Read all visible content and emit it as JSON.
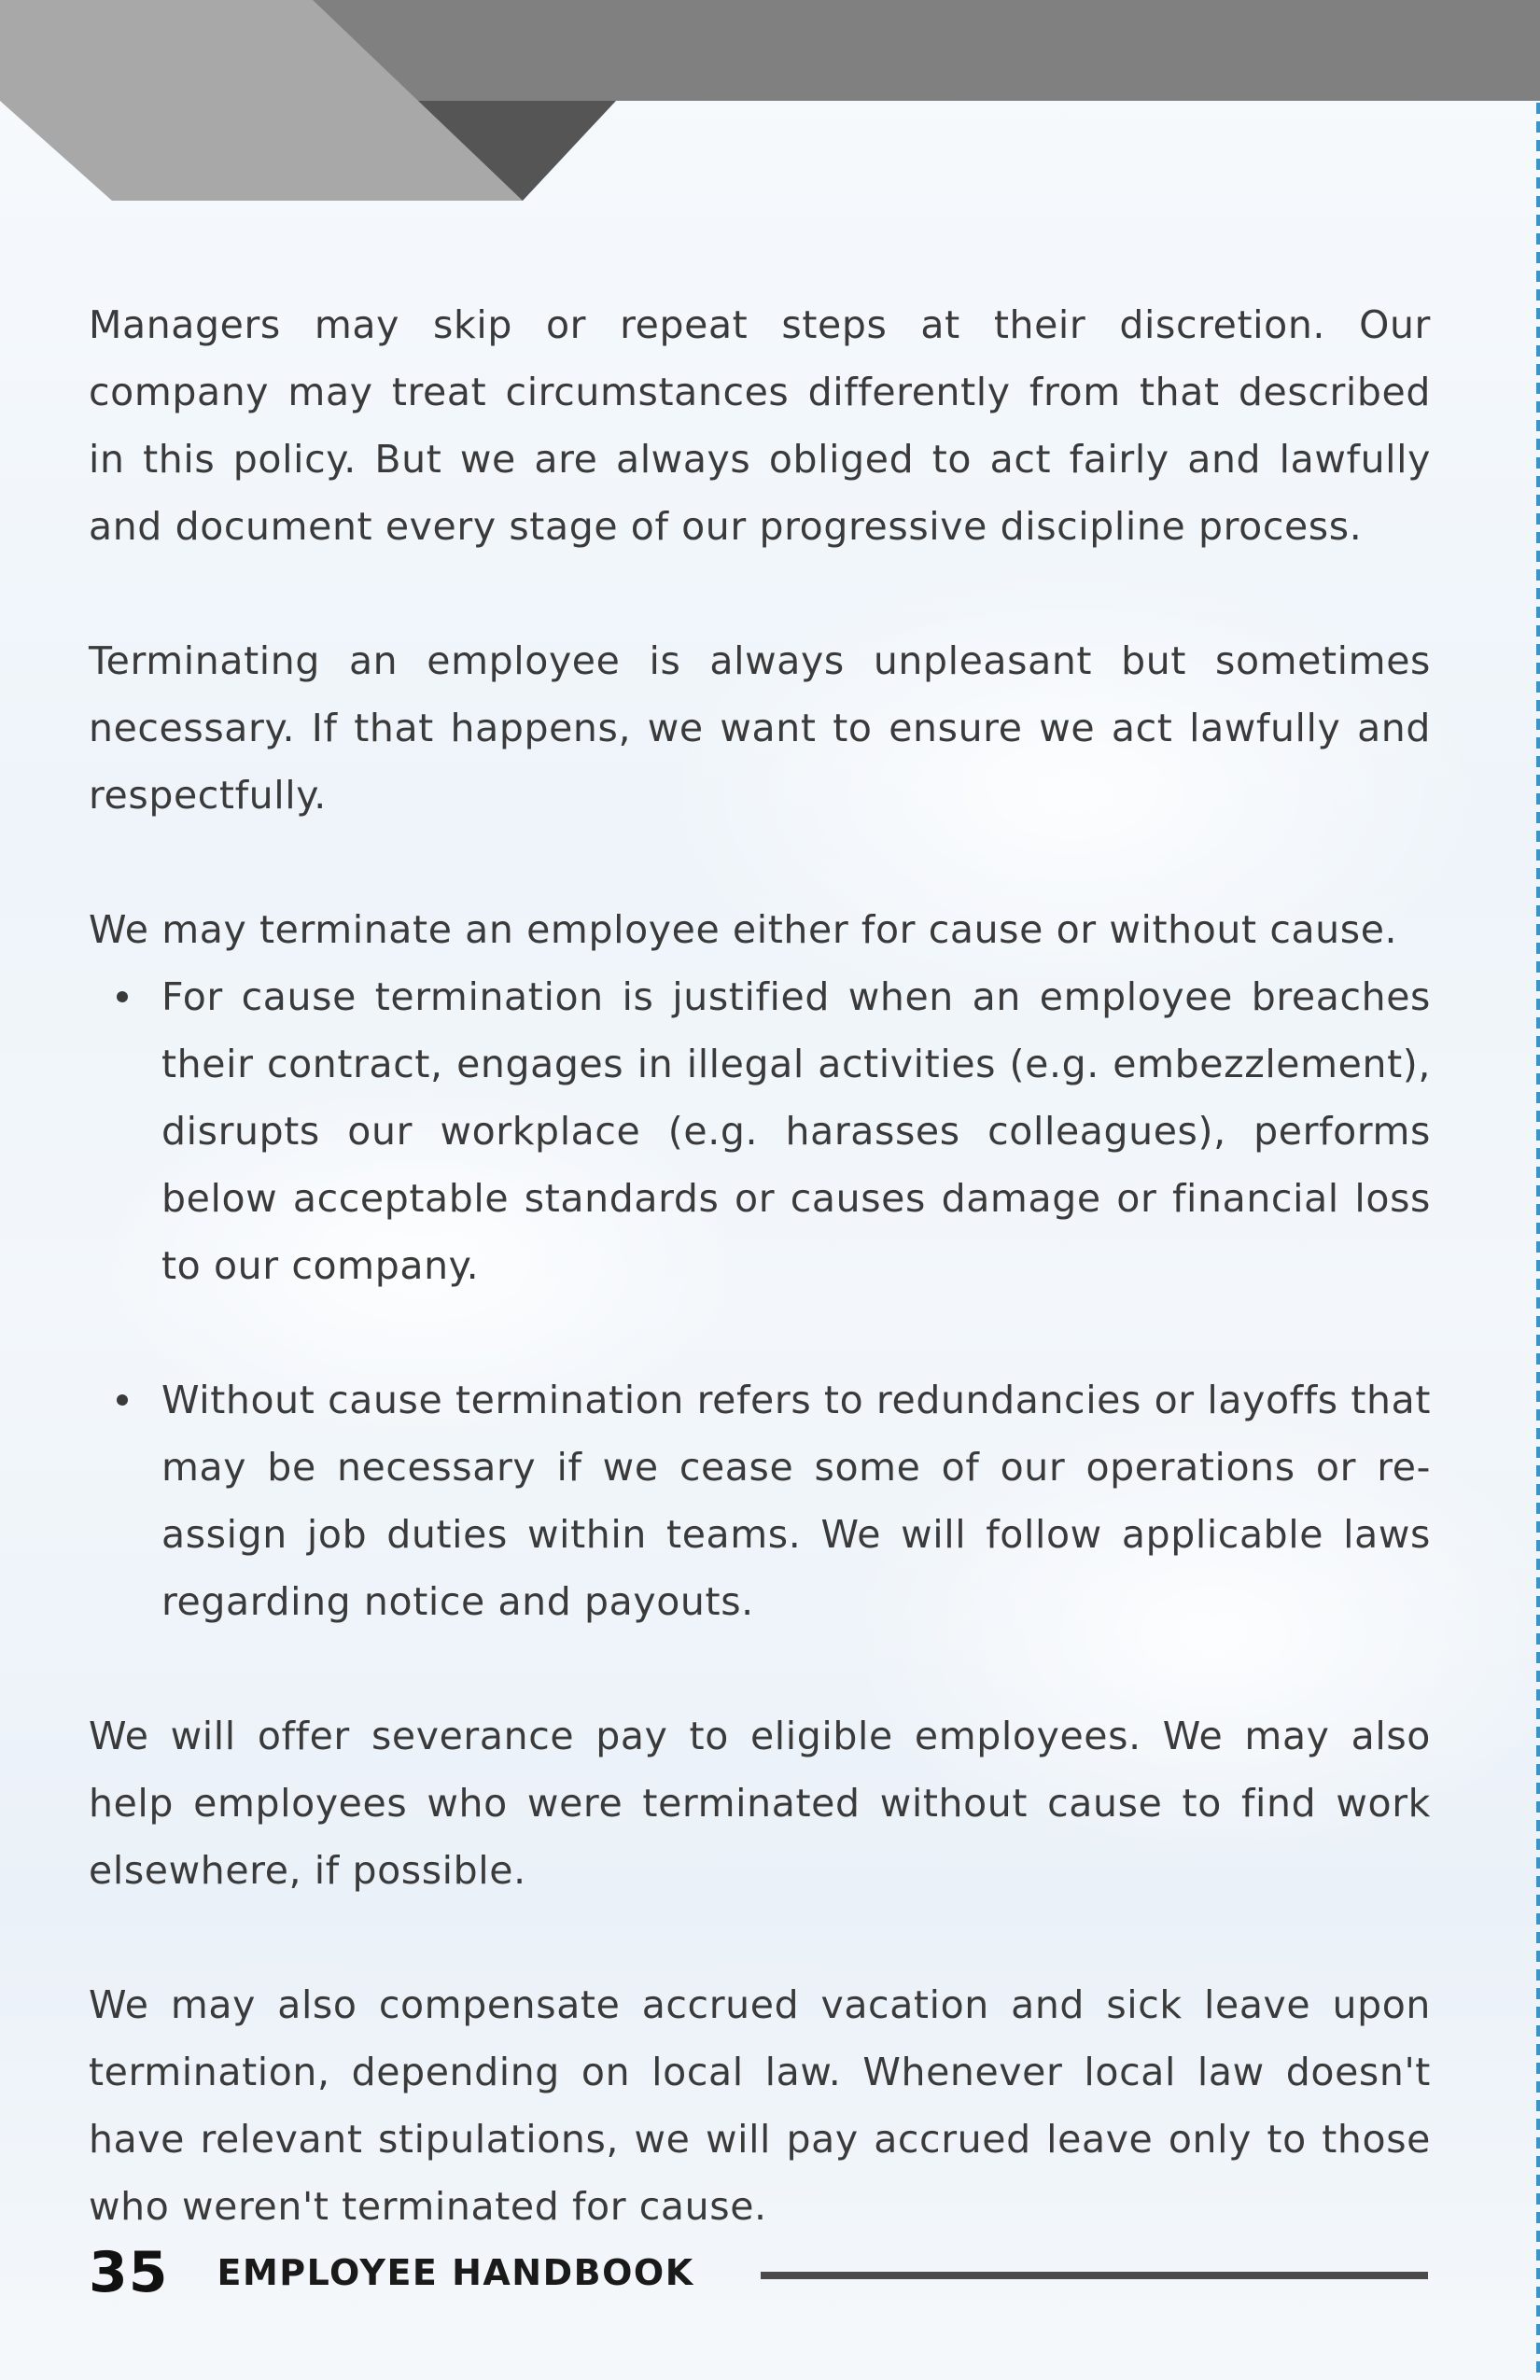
{
  "document": {
    "paragraphs": [
      "Managers may skip or repeat steps at their discretion. Our company may treat circumstances differently from that described in this policy. But we are always obliged to act fairly and lawfully and document every stage of our progressive discipline process.",
      "Terminating an employee is always unpleasant but sometimes necessary. If that happens, we want to ensure we act lawfully and respectfully.",
      "We may terminate an employee either for cause or without cause."
    ],
    "bullets": [
      "For cause termination is justified when an employee breaches their contract, engages in illegal activities (e.g. embezzlement), disrupts our workplace (e.g. harasses colleagues), performs below acceptable standards or causes damage or financial loss to our company.",
      "Without cause termination refers to redundancies or layoffs that may be necessary if we cease some of our operations or re-assign job duties within teams. We will follow applicable laws regarding notice and payouts."
    ],
    "closing_paragraphs": [
      "We will offer severance pay to eligible employees. We may also help employees who were terminated without cause to find work elsewhere, if possible.",
      "We may also compensate accrued vacation and sick leave upon termination, depending on local law. Whenever local law doesn't have relevant stipulations, we will pay accrued leave only to those who weren't terminated for cause."
    ]
  },
  "footer": {
    "page_number": "35",
    "label": "EMPLOYEE HANDBOOK"
  },
  "colors": {
    "header_dark": "#555555",
    "header_mid": "#808080",
    "header_light": "#a8a8a8",
    "border_dash": "#3a94c7",
    "text": "#3a3a3a"
  }
}
